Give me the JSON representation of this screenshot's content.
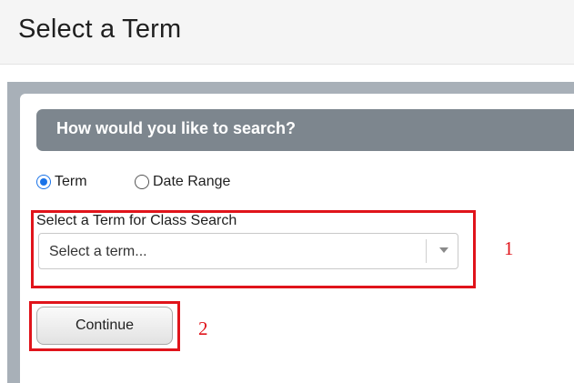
{
  "header": {
    "title": "Select a Term"
  },
  "search_section": {
    "title": "How would you like to search?",
    "options": [
      {
        "label": "Term",
        "checked": true
      },
      {
        "label": "Date Range",
        "checked": false
      }
    ]
  },
  "term_field": {
    "label": "Select a Term for Class Search",
    "value": "Select a term..."
  },
  "actions": {
    "continue_label": "Continue"
  },
  "annotations": {
    "first": "1",
    "second": "2"
  },
  "colors": {
    "header_bg": "#f5f5f5",
    "panel_bg": "#a8b0b8",
    "section_bar": "#7d868e",
    "radio_accent": "#1a73e8",
    "annotation": "#e0141b"
  },
  "icons": {
    "select_arrow": "chevron-down-icon"
  }
}
